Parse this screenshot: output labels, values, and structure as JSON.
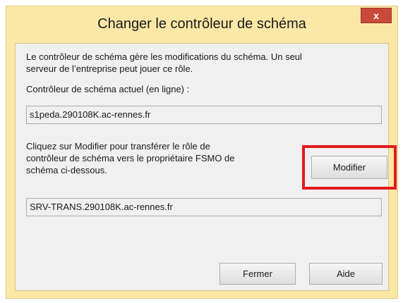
{
  "window": {
    "title": "Changer le contrôleur de schéma",
    "close_glyph": "x"
  },
  "description": {
    "line1": "Le contrôleur de schéma gère les modifications du schéma. Un seul",
    "line2": "serveur de l’entreprise peut jouer ce rôle."
  },
  "current_controller": {
    "label": "Contrôleur de schéma actuel (en ligne) :",
    "value": "s1peda.290108K.ac-rennes.fr"
  },
  "transfer": {
    "line1": "Cliquez sur Modifier pour transférer le rôle de",
    "line2": "contrôleur de schéma vers le propriétaire FSMO de",
    "line3": "schéma ci-dessous.",
    "modify_label": "Modifier",
    "target_value": "SRV-TRANS.290108K.ac-rennes.fr"
  },
  "footer": {
    "close_label": "Fermer",
    "help_label": "Aide"
  },
  "colors": {
    "title_bar": "#fbe8a6",
    "close_button": "#c94a3a",
    "highlight": "#e21a1a"
  }
}
